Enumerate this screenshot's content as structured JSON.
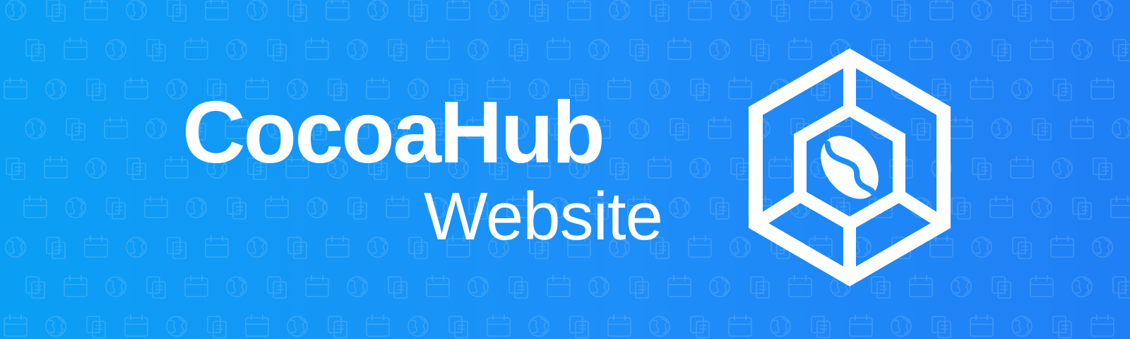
{
  "banner": {
    "title": "CocoaHub",
    "subtitle": "Website"
  },
  "logo": {
    "icon": "hexagon-cube-coffee-bean-icon"
  },
  "pattern": {
    "icons": [
      "globe-icon",
      "documents-icon",
      "calendar-icon"
    ]
  },
  "colors": {
    "background_start": "#0a9ff5",
    "background_end": "#1f7ff5",
    "foreground": "#ffffff"
  }
}
